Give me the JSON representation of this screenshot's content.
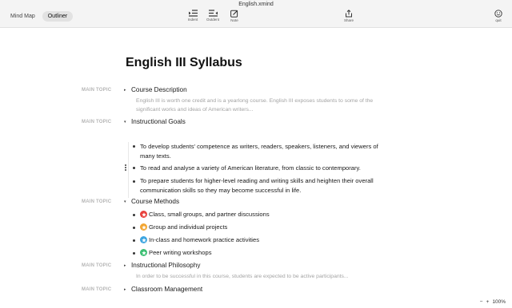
{
  "window": {
    "title": "English.xmind"
  },
  "view_switch": {
    "mindmap": "Mind Map",
    "outliner": "Outliner"
  },
  "tools": {
    "indent": "Indent",
    "outdent": "Outdent",
    "note": "Note",
    "share": "Share",
    "quit": "quit"
  },
  "doc": {
    "title": "English III Syllabus"
  },
  "topics": {
    "t1": {
      "label": "MAIN TOPIC",
      "text": "Course Description",
      "note": "English III is worth one credit and is a yearlong course. English III exposes students to some of the significant works and ideas of American writers..."
    },
    "t2": {
      "label": "MAIN TOPIC",
      "text": "Instructional Goals",
      "subs": [
        "To develop students' competence as writers, readers, speakers, listeners, and viewers of many texts.",
        "To read and analyse a variety of American literature, from classic to contemporary.",
        "To prepare students for higher-level reading and writing skills and heighten their overall communication skills so they may become successful in life."
      ]
    },
    "t3": {
      "label": "MAIN TOPIC",
      "text": "Course Methods",
      "subs": [
        "Class, small groups, and partner discussions",
        "Group and individual projects",
        "In-class and homework practice activities",
        "Peer writing workshops"
      ],
      "star_colors": [
        "#e8403b",
        "#f2a531",
        "#3da5e0",
        "#3cbf73"
      ]
    },
    "t4": {
      "label": "MAIN TOPIC",
      "text": "Instructional Philosophy",
      "note": "In order to be successful in this course, students are expected to be active participants..."
    },
    "t5": {
      "label": "MAIN TOPIC",
      "text": "Classroom Management"
    }
  },
  "zoom": {
    "minus": "−",
    "plus": "+",
    "level": "100%"
  }
}
